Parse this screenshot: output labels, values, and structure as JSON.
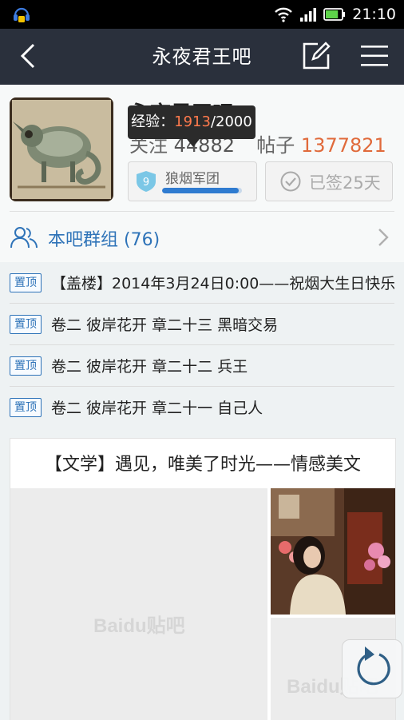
{
  "status_bar": {
    "time": "21:10",
    "icons": [
      "baidu-app-icon",
      "wifi-icon",
      "signal-icon",
      "battery-icon"
    ],
    "battery_level": 0.8
  },
  "nav": {
    "title": "永夜君王吧",
    "icons": [
      "back-chevron-icon",
      "edit-icon",
      "menu-icon"
    ]
  },
  "forum": {
    "name": "永夜君王吧",
    "stats_prefix_hidden": "关注",
    "members": "44882",
    "posts_label_hidden": "帖子",
    "posts": "1377821"
  },
  "tooltip": {
    "label": "经验：",
    "current": "1913",
    "separator": "/",
    "total": "2000"
  },
  "level": {
    "number": "9",
    "title": "狼烟军团",
    "progress": 0.957
  },
  "sign": {
    "text": "已签25天"
  },
  "group": {
    "label": "本吧群组 (76)"
  },
  "pinned": [
    {
      "tag": "置顶",
      "title": "【盖楼】2014年3月24日0:00——祝烟大生日快乐"
    },
    {
      "tag": "置顶",
      "title": "卷二 彼岸花开 章二十三 黑暗交易"
    },
    {
      "tag": "置顶",
      "title": "卷二 彼岸花开 章二十二 兵王"
    },
    {
      "tag": "置顶",
      "title": "卷二 彼岸花开 章二十一 自己人"
    }
  ],
  "card": {
    "title": "【文学】遇见，唯美了时光——情感美文",
    "watermark": "Baidu贴吧"
  },
  "colors": {
    "accent": "#2e73b8",
    "highlight": "#e06a3b",
    "navbar": "#2a303c"
  }
}
